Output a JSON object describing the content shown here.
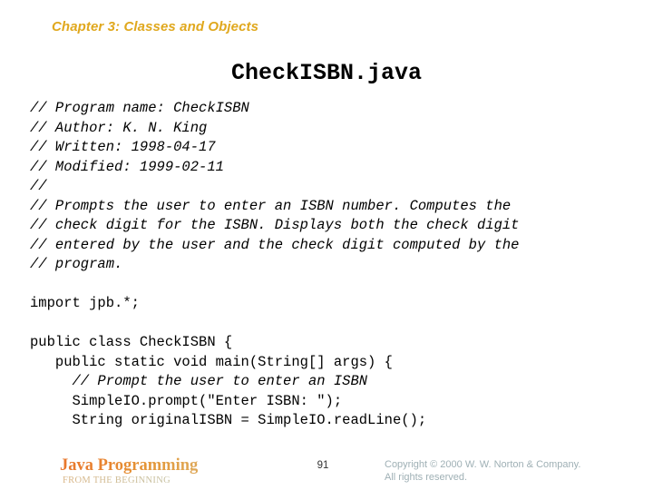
{
  "chapter": {
    "label": "Chapter 3: Classes and Objects",
    "color": "#E0A81E"
  },
  "slide": {
    "title": "CheckISBN.java"
  },
  "code": {
    "lines": [
      {
        "text": "// Program name: CheckISBN",
        "style": "italic"
      },
      {
        "text": "// Author: K. N. King",
        "style": "italic"
      },
      {
        "text": "// Written: 1998-04-17",
        "style": "italic"
      },
      {
        "text": "// Modified: 1999-02-11",
        "style": "italic"
      },
      {
        "text": "//",
        "style": "italic"
      },
      {
        "text": "// Prompts the user to enter an ISBN number. Computes the",
        "style": "italic"
      },
      {
        "text": "// check digit for the ISBN. Displays both the check digit",
        "style": "italic"
      },
      {
        "text": "// entered by the user and the check digit computed by the",
        "style": "italic"
      },
      {
        "text": "// program.",
        "style": "italic"
      },
      {
        "text": "",
        "style": "blank"
      },
      {
        "text": "import jpb.*;",
        "style": "normal"
      },
      {
        "text": "",
        "style": "blank"
      },
      {
        "text": "public class CheckISBN {",
        "style": "normal"
      },
      {
        "text": "   public static void main(String[] args) {",
        "style": "normal"
      },
      {
        "text": "     // Prompt the user to enter an ISBN",
        "style": "italic-indent"
      },
      {
        "text": "     SimpleIO.prompt(\"Enter ISBN: \");",
        "style": "normal"
      },
      {
        "text": "     String originalISBN = SimpleIO.readLine();",
        "style": "normal"
      }
    ]
  },
  "footer": {
    "brand_title": "Java Programming",
    "brand_subtitle": "FROM THE BEGINNING",
    "page_number": "91",
    "copyright_line1": "Copyright © 2000 W. W. Norton & Company.",
    "copyright_line2": "All rights reserved.",
    "brand_color_start": "#E8762C",
    "brand_color_end": "#D9B07A",
    "copyright_color": "#9FB0B5"
  }
}
